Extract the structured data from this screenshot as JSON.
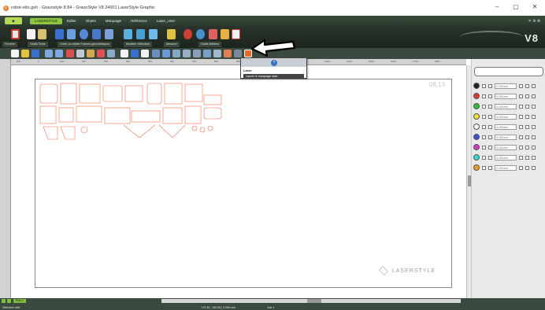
{
  "window": {
    "title": "robot-otto.gsh - Gravostyle 8 84 - GravoStyle V8 24001 LaserStyle Graphic",
    "controls": [
      "–",
      "▢",
      "✕"
    ]
  },
  "menubar": {
    "logo": "◆",
    "items": [
      "LASERSTYLE",
      "Editer",
      "Objets",
      "Marquage",
      "Référence",
      "Laser_User"
    ],
    "right": "✕ ⊕ ⊗"
  },
  "ribbon": {
    "groups": [
      "Fenêtre",
      "Outils Texte",
      "Créer ou éditer Formes géométriques",
      "Modifier Sélection",
      "Mesurer",
      "Outils Métiers"
    ],
    "brand": "V8"
  },
  "ruler": {
    "ticks": [
      "-100",
      "0",
      "100",
      "200",
      "300",
      "400",
      "500",
      "600",
      "700",
      "800",
      "900",
      "1000",
      "1100",
      "1200",
      "1300",
      "1400",
      "1500",
      "1600",
      "1700",
      "1800"
    ]
  },
  "canvas": {
    "page_number": "08.13",
    "watermark": "LASERSTYLE"
  },
  "tooltip": {
    "title": "Laser",
    "description": "Lancer le marquage laser"
  },
  "rightpanel": {
    "rows": [
      {
        "color": "#222222",
        "value": "0.100 mm"
      },
      {
        "color": "#e23b2a",
        "value": "0.100 mm"
      },
      {
        "color": "#2fbf3a",
        "value": "0.100 mm"
      },
      {
        "color": "#f2e33a",
        "value": "0.100 mm"
      },
      {
        "color": "#f5f5f5",
        "value": "0.100 mm"
      },
      {
        "color": "#3a52d6",
        "value": "0.100 mm"
      },
      {
        "color": "#d63ac6",
        "value": "0.100 mm"
      },
      {
        "color": "#3ad6d6",
        "value": "0.100 mm"
      },
      {
        "color": "#f29a2a",
        "value": "0.100 mm"
      }
    ]
  },
  "statusbar": {
    "layer": "Plan 1",
    "status_text": "Sélection vide",
    "coordinates": "170.10 ; 160.00  |  2.000 mm",
    "zoom": "Vue 1"
  },
  "colors": {
    "cut_lines": "#e87050",
    "accent": "#8dc63f",
    "dark_bg": "#2c3a2e"
  }
}
